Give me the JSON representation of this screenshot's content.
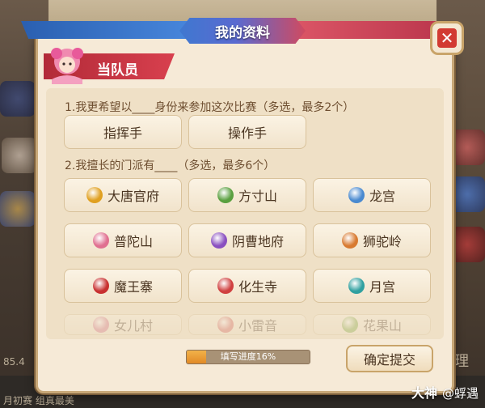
{
  "dialog": {
    "title": "我的资料",
    "close_icon": "close-icon"
  },
  "section": {
    "label": "当队员"
  },
  "question1": {
    "text": "1.我更希望以____身份来参加这次比赛（多选，最多2个）",
    "options": [
      {
        "label": "指挥手"
      },
      {
        "label": "操作手"
      }
    ]
  },
  "question2": {
    "text": "2.我擅长的门派有____（多选，最多6个）",
    "options": [
      {
        "label": "大唐官府",
        "icon": "datang-icon",
        "color": "#e0a020"
      },
      {
        "label": "方寸山",
        "icon": "fangcun-icon",
        "color": "#5aa040"
      },
      {
        "label": "龙宫",
        "icon": "longgong-icon",
        "color": "#4a8ad0"
      },
      {
        "label": "普陀山",
        "icon": "putuo-icon",
        "color": "#e07090"
      },
      {
        "label": "阴曹地府",
        "icon": "yincao-icon",
        "color": "#8a50c0"
      },
      {
        "label": "狮驼岭",
        "icon": "shituo-icon",
        "color": "#d87a30"
      },
      {
        "label": "魔王寨",
        "icon": "mowang-icon",
        "color": "#c83030"
      },
      {
        "label": "化生寺",
        "icon": "huasheng-icon",
        "color": "#d04040"
      },
      {
        "label": "月宫",
        "icon": "yuegong-icon",
        "color": "#30a0a0"
      },
      {
        "label": "女儿村",
        "icon": "nuer-icon",
        "color": "#d06080"
      },
      {
        "label": "小雷音",
        "icon": "xiaoleiyin-icon",
        "color": "#d05050"
      },
      {
        "label": "花果山",
        "icon": "huaguo-icon",
        "color": "#70a030"
      }
    ]
  },
  "footer": {
    "progress_label": "填写进度16%",
    "progress": 0.16,
    "submit_label": "确定提交"
  },
  "background": {
    "bottom_left_value": "85.4",
    "bottom_text": "月初赛   组真最美",
    "right_char": "理"
  },
  "watermark": {
    "brand": "大神",
    "user": "@蜉遇"
  }
}
